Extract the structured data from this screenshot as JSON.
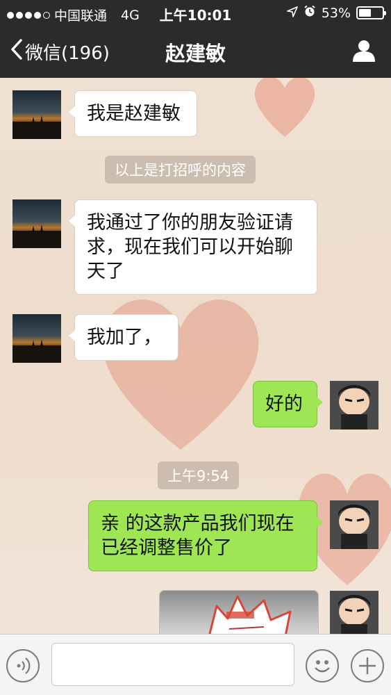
{
  "status_bar": {
    "carrier": "中国联通",
    "network": "4G",
    "time": "上午10:01",
    "battery": "53%",
    "battery_level": 0.53
  },
  "nav": {
    "back_label": "微信(196)",
    "title": "赵建敏",
    "profile_icon": "person-icon"
  },
  "messages": [
    {
      "side": "left",
      "text": "我是赵建敏"
    },
    {
      "type": "system",
      "text": "以上是打招呼的内容"
    },
    {
      "side": "left",
      "text": "我通过了你的朋友验证请求，现在我们可以开始聊天了"
    },
    {
      "side": "left",
      "text": "我加了，"
    },
    {
      "side": "right",
      "text": "好的"
    },
    {
      "type": "timestamp",
      "text": "上午9:54"
    },
    {
      "side": "right",
      "text": "亲 的这款产品我们现在已经调整售价了"
    },
    {
      "side": "right",
      "type": "image"
    }
  ],
  "input_bar": {
    "voice_icon": "voice-icon",
    "emoji_icon": "emoji-icon",
    "plus_icon": "plus-icon"
  },
  "colors": {
    "nav_bg": "#2b2b2b",
    "bubble_left": "#ffffff",
    "bubble_right": "#9ee654",
    "chat_bg": "#efe2d6"
  }
}
